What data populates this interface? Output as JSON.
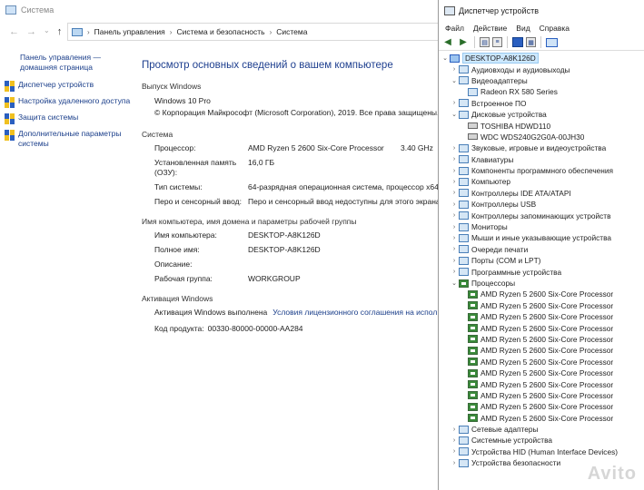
{
  "system_window": {
    "title": "Система",
    "address": {
      "crumbs": [
        "Панель управления",
        "Система и безопасность",
        "Система"
      ]
    },
    "left_pane": {
      "home_link": "Панель управления — домашняя страница",
      "links": [
        "Диспетчер устройств",
        "Настройка удаленного доступа",
        "Защита системы",
        "Дополнительные параметры системы"
      ]
    },
    "heading": "Просмотр основных сведений о вашем компьютере",
    "edition": {
      "section": "Выпуск Windows",
      "name": "Windows 10 Pro",
      "copyright": "© Корпорация Майкрософт (Microsoft Corporation), 2019. Все права защищены."
    },
    "system": {
      "section": "Система",
      "rows": [
        {
          "k": "Процессор:",
          "v": "AMD Ryzen 5 2600 Six-Core Processor",
          "extra": "3.40 GHz"
        },
        {
          "k": "Установленная память (ОЗУ):",
          "v": "16,0 ГБ"
        },
        {
          "k": "Тип системы:",
          "v": "64-разрядная операционная система, процессор x64"
        },
        {
          "k": "Перо и сенсорный ввод:",
          "v": "Перо и сенсорный ввод недоступны для этого экрана"
        }
      ]
    },
    "computer": {
      "section": "Имя компьютера, имя домена и параметры рабочей группы",
      "rows": [
        {
          "k": "Имя компьютера:",
          "v": "DESKTOP-A8K126D"
        },
        {
          "k": "Полное имя:",
          "v": "DESKTOP-A8K126D"
        },
        {
          "k": "Описание:",
          "v": ""
        },
        {
          "k": "Рабочая группа:",
          "v": "WORKGROUP"
        }
      ]
    },
    "activation": {
      "section": "Активация Windows",
      "status": "Активация Windows выполнена",
      "license_link": "Условия лицензионного соглашения на испол",
      "product_label": "Код продукта:",
      "product_id": "00330-80000-00000-AA284"
    }
  },
  "device_manager": {
    "title": "Диспетчер устройств",
    "menu": [
      "Файл",
      "Действие",
      "Вид",
      "Справка"
    ],
    "root": "DESKTOP-A8K126D",
    "tree": [
      {
        "label": "Аудиовходы и аудиовыходы",
        "state": "collapsed",
        "level": 1
      },
      {
        "label": "Видеоадаптеры",
        "state": "expanded",
        "level": 1
      },
      {
        "label": "Radeon RX 580 Series",
        "state": "leaf",
        "level": 2
      },
      {
        "label": "Встроенное ПО",
        "state": "collapsed",
        "level": 1
      },
      {
        "label": "Дисковые устройства",
        "state": "expanded",
        "level": 1
      },
      {
        "label": "TOSHIBA HDWD110",
        "state": "leaf",
        "level": 2,
        "icon": "disk"
      },
      {
        "label": "WDC WDS240G2G0A-00JH30",
        "state": "leaf",
        "level": 2,
        "icon": "disk"
      },
      {
        "label": "Звуковые, игровые и видеоустройства",
        "state": "collapsed",
        "level": 1
      },
      {
        "label": "Клавиатуры",
        "state": "collapsed",
        "level": 1
      },
      {
        "label": "Компоненты программного обеспечения",
        "state": "collapsed",
        "level": 1
      },
      {
        "label": "Компьютер",
        "state": "collapsed",
        "level": 1
      },
      {
        "label": "Контроллеры IDE ATA/ATAPI",
        "state": "collapsed",
        "level": 1
      },
      {
        "label": "Контроллеры USB",
        "state": "collapsed",
        "level": 1
      },
      {
        "label": "Контроллеры запоминающих устройств",
        "state": "collapsed",
        "level": 1
      },
      {
        "label": "Мониторы",
        "state": "collapsed",
        "level": 1
      },
      {
        "label": "Мыши и иные указывающие устройства",
        "state": "collapsed",
        "level": 1
      },
      {
        "label": "Очереди печати",
        "state": "collapsed",
        "level": 1
      },
      {
        "label": "Порты (COM и LPT)",
        "state": "collapsed",
        "level": 1
      },
      {
        "label": "Программные устройства",
        "state": "collapsed",
        "level": 1
      },
      {
        "label": "Процессоры",
        "state": "expanded",
        "level": 1,
        "icon": "chip"
      },
      {
        "label": "AMD Ryzen 5 2600 Six-Core Processor",
        "state": "leaf",
        "level": 2,
        "icon": "chip"
      },
      {
        "label": "AMD Ryzen 5 2600 Six-Core Processor",
        "state": "leaf",
        "level": 2,
        "icon": "chip"
      },
      {
        "label": "AMD Ryzen 5 2600 Six-Core Processor",
        "state": "leaf",
        "level": 2,
        "icon": "chip"
      },
      {
        "label": "AMD Ryzen 5 2600 Six-Core Processor",
        "state": "leaf",
        "level": 2,
        "icon": "chip"
      },
      {
        "label": "AMD Ryzen 5 2600 Six-Core Processor",
        "state": "leaf",
        "level": 2,
        "icon": "chip"
      },
      {
        "label": "AMD Ryzen 5 2600 Six-Core Processor",
        "state": "leaf",
        "level": 2,
        "icon": "chip"
      },
      {
        "label": "AMD Ryzen 5 2600 Six-Core Processor",
        "state": "leaf",
        "level": 2,
        "icon": "chip"
      },
      {
        "label": "AMD Ryzen 5 2600 Six-Core Processor",
        "state": "leaf",
        "level": 2,
        "icon": "chip"
      },
      {
        "label": "AMD Ryzen 5 2600 Six-Core Processor",
        "state": "leaf",
        "level": 2,
        "icon": "chip"
      },
      {
        "label": "AMD Ryzen 5 2600 Six-Core Processor",
        "state": "leaf",
        "level": 2,
        "icon": "chip"
      },
      {
        "label": "AMD Ryzen 5 2600 Six-Core Processor",
        "state": "leaf",
        "level": 2,
        "icon": "chip"
      },
      {
        "label": "AMD Ryzen 5 2600 Six-Core Processor",
        "state": "leaf",
        "level": 2,
        "icon": "chip"
      },
      {
        "label": "Сетевые адаптеры",
        "state": "collapsed",
        "level": 1
      },
      {
        "label": "Системные устройства",
        "state": "collapsed",
        "level": 1
      },
      {
        "label": "Устройства HID (Human Interface Devices)",
        "state": "collapsed",
        "level": 1
      },
      {
        "label": "Устройства безопасности",
        "state": "collapsed",
        "level": 1
      }
    ]
  },
  "watermark": "Avito"
}
